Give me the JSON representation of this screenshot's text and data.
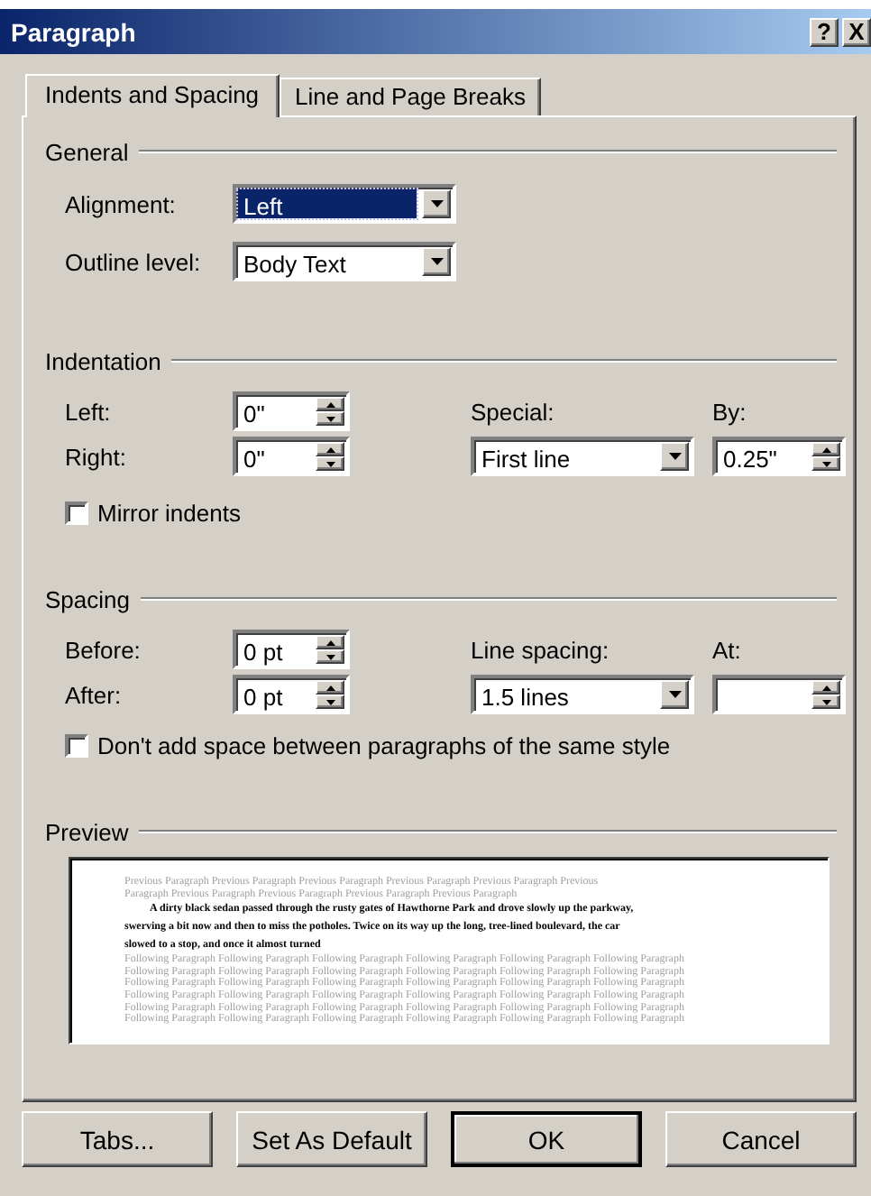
{
  "window": {
    "title": "Paragraph",
    "help_button": "?",
    "close_button": "X"
  },
  "tabs": [
    {
      "label": "Indents and Spacing",
      "selected": true
    },
    {
      "label": "Line and Page Breaks",
      "selected": false
    }
  ],
  "general": {
    "heading": "General",
    "alignment": {
      "label": "Alignment:",
      "value": "Left",
      "focused": true
    },
    "outline_level": {
      "label": "Outline level:",
      "value": "Body Text",
      "focused": false
    }
  },
  "indentation": {
    "heading": "Indentation",
    "left": {
      "label": "Left:",
      "value": "0\""
    },
    "right": {
      "label": "Right:",
      "value": "0\""
    },
    "special": {
      "label": "Special:",
      "value": "First line"
    },
    "by": {
      "label": "By:",
      "value": "0.25\""
    },
    "mirror_indents": {
      "label": "Mirror indents",
      "checked": false
    }
  },
  "spacing": {
    "heading": "Spacing",
    "before": {
      "label": "Before:",
      "value": "0 pt"
    },
    "after": {
      "label": "After:",
      "value": "0 pt"
    },
    "line_spacing": {
      "label": "Line spacing:",
      "value": "1.5 lines"
    },
    "at": {
      "label": "At:"
    },
    "dont_add_space": {
      "label": "Don't add space between paragraphs of the same style",
      "checked": false
    }
  },
  "preview": {
    "heading": "Preview",
    "previous_lines": [
      "Previous Paragraph Previous Paragraph Previous Paragraph Previous Paragraph Previous Paragraph Previous",
      "Paragraph Previous Paragraph Previous Paragraph Previous Paragraph Previous Paragraph"
    ],
    "sample_lines": [
      "A dirty black sedan passed through the rusty gates of Hawthorne Park and drove slowly up the parkway,",
      "swerving a bit now and then to miss the potholes. Twice on its way up the long, tree-lined boulevard, the car",
      "slowed to a stop, and once it almost turned"
    ],
    "following_lines": [
      "Following Paragraph Following Paragraph Following Paragraph Following Paragraph Following Paragraph Following Paragraph",
      "Following Paragraph Following Paragraph Following Paragraph Following Paragraph Following Paragraph Following Paragraph",
      "Following Paragraph Following Paragraph Following Paragraph Following Paragraph Following Paragraph Following Paragraph",
      "Following Paragraph Following Paragraph Following Paragraph Following Paragraph Following Paragraph Following Paragraph",
      "Following Paragraph Following Paragraph Following Paragraph Following Paragraph Following Paragraph Following Paragraph",
      "Following Paragraph Following Paragraph Following Paragraph Following Paragraph Following Paragraph Following Paragraph"
    ]
  },
  "buttons": [
    {
      "label": "Tabs...",
      "default": false
    },
    {
      "label": "Set As Default",
      "default": false
    },
    {
      "label": "OK",
      "default": true
    },
    {
      "label": "Cancel",
      "default": false
    }
  ]
}
